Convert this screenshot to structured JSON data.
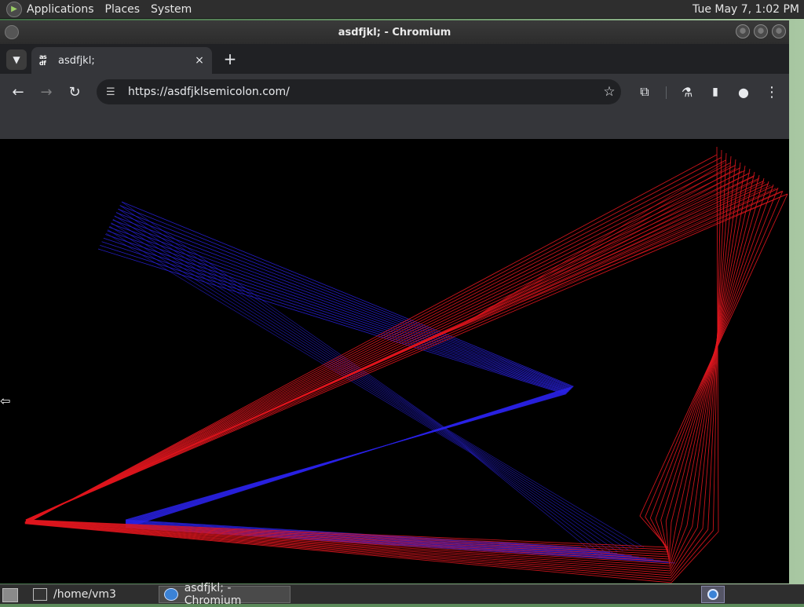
{
  "top_panel": {
    "menus": [
      "Applications",
      "Places",
      "System"
    ],
    "clock": "Tue May  7,  1:02 PM"
  },
  "window": {
    "title": "asdfjkl; - Chromium"
  },
  "tab": {
    "favicon_text": "as df",
    "title": "asdfjkl;",
    "close_icon": "×",
    "new_tab_icon": "+"
  },
  "toolbar": {
    "back_icon": "←",
    "forward_icon": "→",
    "reload_icon": "↻",
    "url": "https://asdfjklsemicolon.com/",
    "star_icon": "☆",
    "extensions_icon": "⧉",
    "labs_icon": "⚗",
    "sidepanel_icon": "▮",
    "profile_icon": "●",
    "menu_icon": "⋮"
  },
  "taskbar": {
    "tasks": [
      {
        "label": "/home/vm3"
      },
      {
        "label": "asdfjkl; - Chromium"
      }
    ]
  },
  "colors": {
    "red_lines": "#e0161e",
    "blue_lines": "#2a22e6",
    "canvas_bg": "#000000"
  }
}
